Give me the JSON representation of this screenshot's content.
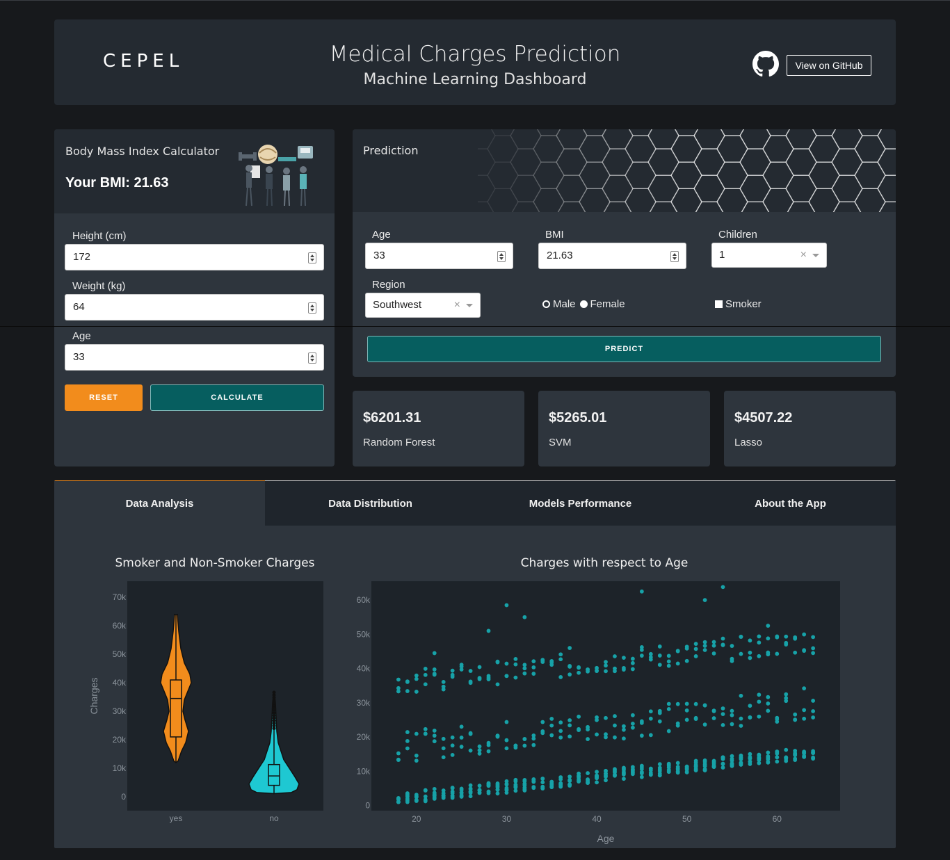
{
  "header": {
    "logo": "CEPEL",
    "title": "Medical Charges Prediction",
    "subtitle": "Machine Learning Dashboard",
    "github_button": "View on GitHub"
  },
  "bmi": {
    "title": "Body Mass Index Calculator",
    "result": "Your BMI: 21.63",
    "height_label": "Height (cm)",
    "height_value": "172",
    "weight_label": "Weight (kg)",
    "weight_value": "64",
    "age_label": "Age",
    "age_value": "33",
    "reset_label": "RESET",
    "calculate_label": "CALCULATE"
  },
  "prediction": {
    "title": "Prediction",
    "age_label": "Age",
    "age_value": "33",
    "bmi_label": "BMI",
    "bmi_value": "21.63",
    "children_label": "Children",
    "children_value": "1",
    "region_label": "Region",
    "region_value": "Southwest",
    "male_label": "Male",
    "female_label": "Female",
    "smoker_label": "Smoker",
    "selected_sex": "Female",
    "smoker_checked": true,
    "predict_label": "PREDICT"
  },
  "results": [
    {
      "value": "$6201.31",
      "model": "Random Forest"
    },
    {
      "value": "$5265.01",
      "model": "SVM"
    },
    {
      "value": "$4507.22",
      "model": "Lasso"
    }
  ],
  "tabs": [
    "Data Analysis",
    "Data Distribution",
    "Models Performance",
    "About the App"
  ],
  "active_tab": "Data Analysis",
  "colors": {
    "accent_orange": "#f28c1c",
    "teal_button": "#065e5f",
    "scatter_teal": "#17a2a8",
    "violin_cyan": "#1ec8d2",
    "card_bg": "#2e353d",
    "page_bg": "#17191c"
  },
  "icons": {
    "github": "github-icon",
    "illustration": "bmi-illustration"
  },
  "chart_data": [
    {
      "type": "violin",
      "title": "Smoker and Non-Smoker Charges",
      "xlabel": "",
      "ylabel": "Charges",
      "categories": [
        "yes",
        "no"
      ],
      "ylim": [
        0,
        72000
      ],
      "yticks": [
        0,
        10000,
        20000,
        30000,
        40000,
        50000,
        60000,
        70000
      ],
      "ytick_labels": [
        "0",
        "10k",
        "20k",
        "30k",
        "40k",
        "50k",
        "60k",
        "70k"
      ],
      "series": [
        {
          "category": "yes",
          "min": 12000,
          "q1": 21000,
          "median": 34500,
          "q3": 41000,
          "max": 63800,
          "color": "#f28c1c"
        },
        {
          "category": "no",
          "min": 1100,
          "q1": 4000,
          "median": 7300,
          "q3": 11300,
          "max": 36900,
          "color": "#1ec8d2"
        }
      ]
    },
    {
      "type": "scatter",
      "title": "Charges with respect to Age",
      "xlabel": "Age",
      "ylabel": "",
      "xlim": [
        15,
        67
      ],
      "ylim": [
        -1500,
        65500
      ],
      "xticks": [
        20,
        30,
        40,
        50,
        60
      ],
      "yticks": [
        0,
        10000,
        20000,
        30000,
        40000,
        50000,
        60000
      ],
      "ytick_labels": [
        "0",
        "10k",
        "20k",
        "30k",
        "40k",
        "50k",
        "60k"
      ],
      "color": "#17a2a8",
      "bands": [
        {
          "name": "low",
          "start": 2000,
          "end": 15500,
          "spread": 3500
        },
        {
          "name": "middle",
          "start": 17000,
          "end": 30000,
          "spread": 9000
        },
        {
          "name": "high",
          "start": 36000,
          "end": 48000,
          "spread": 7000
        }
      ],
      "outliers": [
        [
          28,
          51000
        ],
        [
          30,
          58500
        ],
        [
          32,
          55000
        ],
        [
          45,
          62500
        ],
        [
          52,
          60000
        ],
        [
          54,
          63800
        ],
        [
          59,
          52500
        ],
        [
          22,
          44500
        ],
        [
          37,
          46000
        ]
      ]
    }
  ]
}
